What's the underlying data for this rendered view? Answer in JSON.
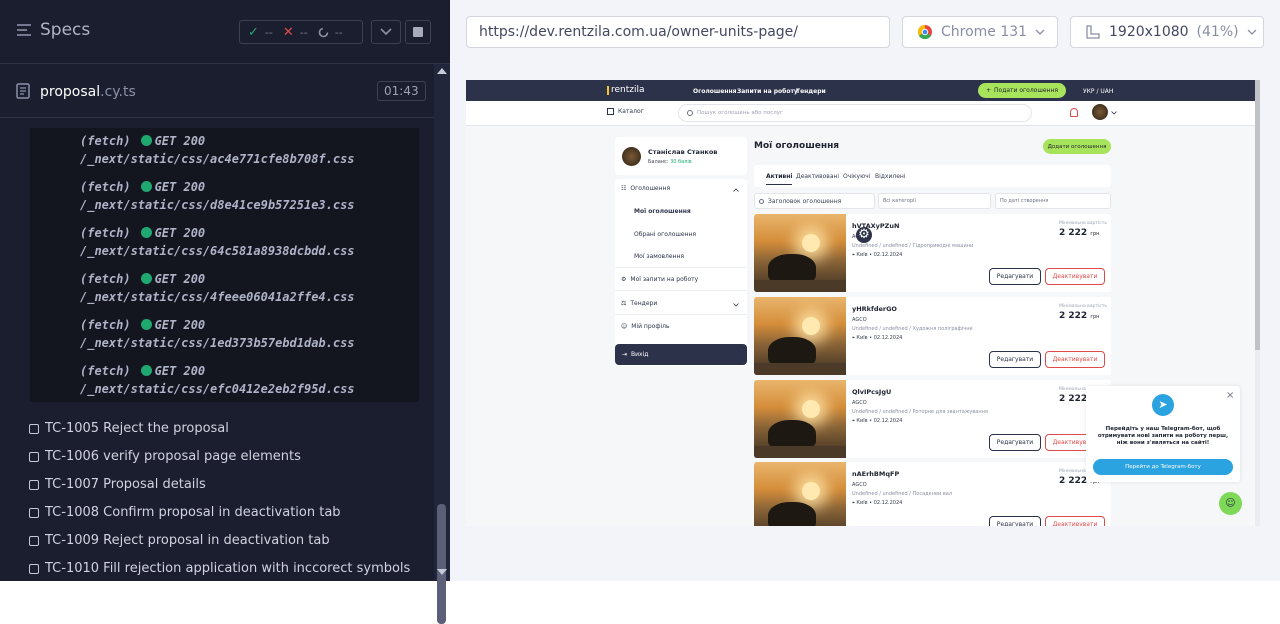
{
  "runner": {
    "title": "Specs",
    "stats": {
      "passed": "--",
      "failed": "--",
      "pending": "--"
    },
    "file": {
      "name": "proposal",
      "ext": ".cy.ts",
      "duration": "01:43"
    },
    "log": [
      {
        "method": "(fetch)",
        "status": "GET 200",
        "path": "/_next/static/css/ac4e771cfe8b708f.css"
      },
      {
        "method": "(fetch)",
        "status": "GET 200",
        "path": "/_next/static/css/d8e41ce9b57251e3.css"
      },
      {
        "method": "(fetch)",
        "status": "GET 200",
        "path": "/_next/static/css/64c581a8938dcbdd.css"
      },
      {
        "method": "(fetch)",
        "status": "GET 200",
        "path": "/_next/static/css/4feee06041a2ffe4.css"
      },
      {
        "method": "(fetch)",
        "status": "GET 200",
        "path": "/_next/static/css/1ed373b57ebd1dab.css"
      },
      {
        "method": "(fetch)",
        "status": "GET 200",
        "path": "/_next/static/css/efc0412e2eb2f95d.css"
      }
    ],
    "tests": [
      "TC-1005 Reject the proposal",
      "TC-1006 verify proposal page elements",
      "TC-1007 Proposal details",
      "TC-1008 Confirm proposal in deactivation tab",
      "TC-1009 Reject proposal in deactivation tab",
      "TC-1010 Fill rejection application with inccorect symbols"
    ]
  },
  "browser": {
    "url": "https://dev.rentzila.com.ua/owner-units-page/",
    "name": "Chrome 131",
    "viewport": "1920x1080",
    "zoom": "(41%)"
  },
  "site": {
    "logo": "rentzila",
    "nav": [
      "Оголошення",
      "Запити на роботу",
      "Тендери"
    ],
    "post_ad": "Подати оголошення",
    "lang": "УКР / UAH",
    "catalog": "Каталог",
    "search_placeholder": "Пошук оголошень або послуг",
    "user": {
      "name": "Станіслав Станков",
      "balance_label": "Баланс:",
      "balance_value": "30 балів"
    },
    "menu": {
      "ads": "Оголошення",
      "my_ads": "Мої оголошення",
      "favorites": "Обрані оголошення",
      "orders": "Мої замовлення",
      "requests": "Мої запити на роботу",
      "tenders": "Тендери",
      "profile": "Мій профіль",
      "logout": "Вихід"
    },
    "page_title": "Мої оголошення",
    "add_ad": "Додати оголошення",
    "tabs": [
      "Активні",
      "Деактивовані",
      "Очікуючі",
      "Відхилені"
    ],
    "filter_search": "Заголовок оголошення",
    "filter_category": "Всі категорії",
    "filter_sort": "По даті створення",
    "price_label": "Мінімальна вартість",
    "currency": "грн",
    "edit_btn": "Редагувати",
    "deactivate_btn": "Деактивувати",
    "listings": [
      {
        "title": "hVTAXyPZuN",
        "brand": "AGCO",
        "category": "Undefined / undefined / Гідроприводні машини",
        "city": "Київ",
        "date": "02.12.2024",
        "price": "2 222"
      },
      {
        "title": "yHRkfderGO",
        "brand": "AGCO",
        "category": "Undefined / undefined / Художня поліграфічне",
        "city": "Київ",
        "date": "02.12.2024",
        "price": "2 222"
      },
      {
        "title": "QlvIPcsJgU",
        "brand": "AGCO",
        "category": "Undefined / undefined / Роторне для звантажування",
        "city": "Київ",
        "date": "02.12.2024",
        "price": "2 222"
      },
      {
        "title": "nAErhBMqFP",
        "brand": "AGCO",
        "category": "Undefined / undefined / Посадкнеи вал",
        "city": "Київ",
        "date": "02.12.2024",
        "price": "2 222"
      }
    ],
    "telegram": {
      "text": "Перейдіть у наш Telegram-бот, щоб отримувати нові запити на роботу перш, ніж вони з'являться на сайті!",
      "button": "Перейти до Telegram-боту"
    }
  }
}
